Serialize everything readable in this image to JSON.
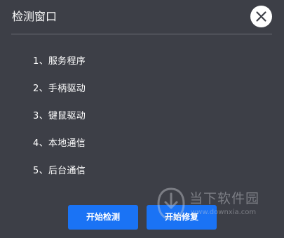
{
  "dialog": {
    "title": "检测窗口",
    "close_icon": "close-icon"
  },
  "items": [
    "1、服务程序",
    "2、手柄驱动",
    "3、键鼠驱动",
    "4、本地通信",
    "5、后台通信"
  ],
  "buttons": {
    "start_label": "开始检测",
    "repair_label": "开始修复"
  },
  "watermark": {
    "title": "当下软件园",
    "url": "www.downxia.com"
  },
  "colors": {
    "background": "#3d3f47",
    "accent": "#1a73f5",
    "text": "#ffffff"
  }
}
